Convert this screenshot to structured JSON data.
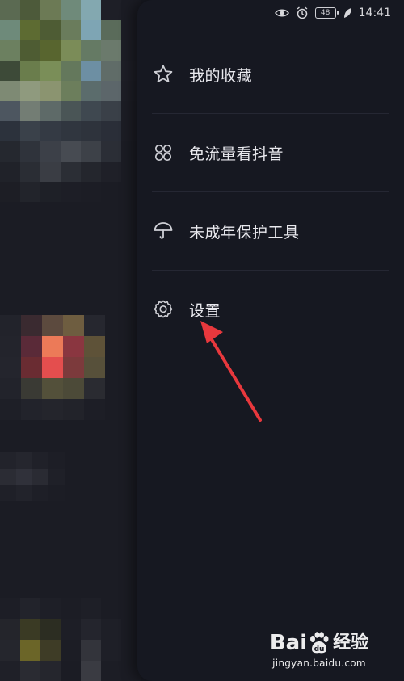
{
  "status_bar": {
    "battery": "48",
    "time": "14:41"
  },
  "menu": {
    "items": [
      {
        "label": "我的收藏",
        "icon": "star-icon"
      },
      {
        "label": "免流量看抖音",
        "icon": "four-circles-icon"
      },
      {
        "label": "未成年保护工具",
        "icon": "umbrella-icon"
      },
      {
        "label": "设置",
        "icon": "gear-icon"
      }
    ]
  },
  "watermark": {
    "brand": "Baidu经验",
    "brand_text": "Bai",
    "brand_du": "du",
    "brand_cn": "经验",
    "url": "jingyan.baidu.com"
  },
  "colors": {
    "drawer_bg": "#161821",
    "annotation": "#e8383d",
    "text": "#e9e9ee"
  }
}
